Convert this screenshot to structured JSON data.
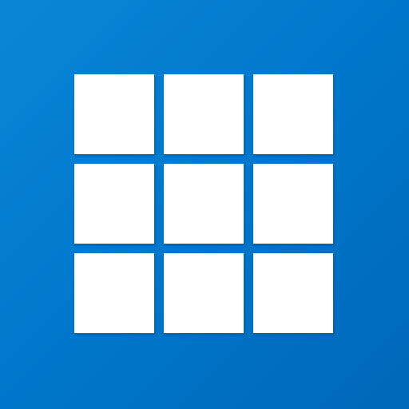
{
  "icon": {
    "name": "grid-app-icon",
    "background_color": "#0077cc",
    "tile_color": "#ffffff",
    "grid": {
      "rows": 3,
      "columns": 3
    }
  }
}
